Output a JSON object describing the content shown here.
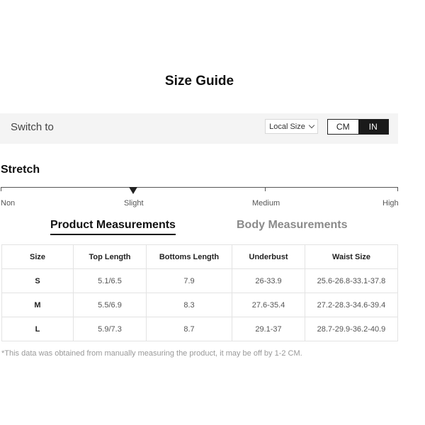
{
  "title": "Size Guide",
  "switch_bar": {
    "label": "Switch to",
    "local_size": "Local Size",
    "units": [
      "CM",
      "IN"
    ],
    "selected_unit": "IN"
  },
  "stretch": {
    "title": "Stretch",
    "levels": [
      "Non",
      "Slight",
      "Medium",
      "High"
    ],
    "selected": "Slight"
  },
  "tabs": {
    "product": "Product Measurements",
    "body": "Body Measurements",
    "active": "Product Measurements"
  },
  "table": {
    "headers": [
      "Size",
      "Top Length",
      "Bottoms Length",
      "Underbust",
      "Waist Size"
    ],
    "rows": [
      [
        "S",
        "5.1/6.5",
        "7.9",
        "26-33.9",
        "25.6-26.8-33.1-37.8"
      ],
      [
        "M",
        "5.5/6.9",
        "8.3",
        "27.6-35.4",
        "27.2-28.3-34.6-39.4"
      ],
      [
        "L",
        "5.9/7.3",
        "8.7",
        "29.1-37",
        "28.7-29.9-36.2-40.9"
      ]
    ]
  },
  "note": "*This data was obtained from manually measuring the product, it may be off by 1-2 CM."
}
